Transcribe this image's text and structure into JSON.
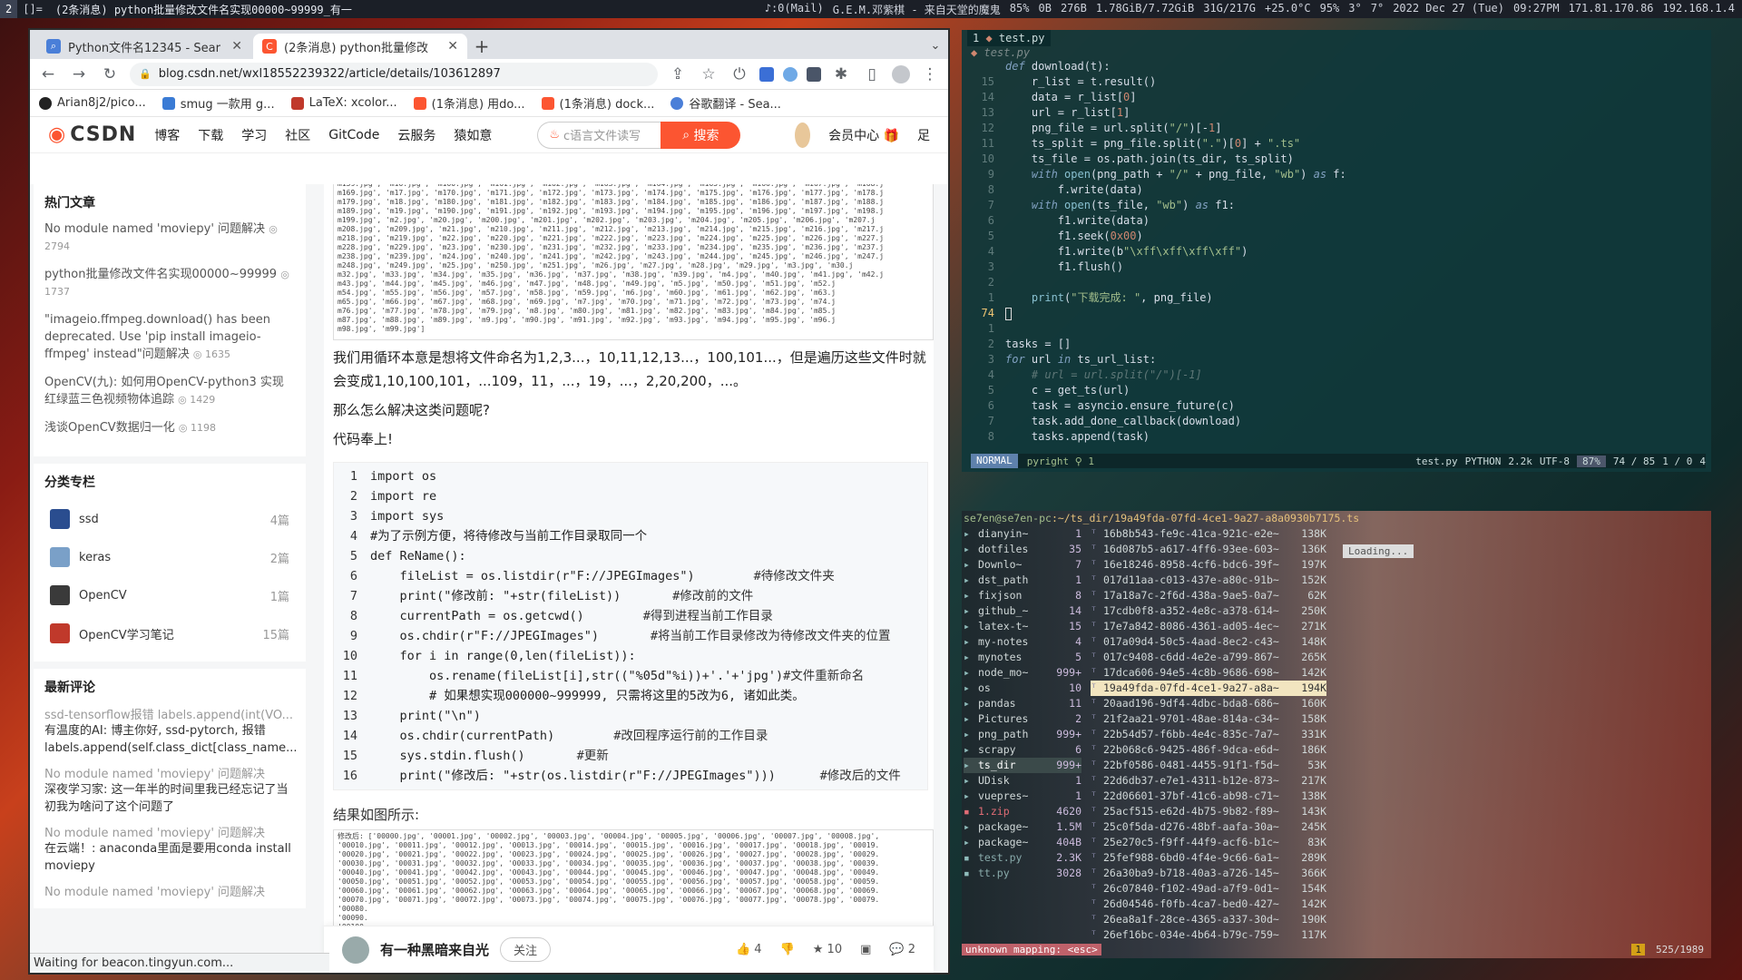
{
  "topbar": {
    "workspaces": [
      "2",
      "[]="
    ],
    "window_title": "(2条消息) python批量修改文件名实现00000~99999_有一",
    "stats": [
      "♪:0(Mail)",
      "G.E.M.邓紫棋 - 来自天堂的魔鬼",
      "85%",
      "0B",
      "276B",
      "1.78GiB/7.72GiB",
      "31G/217G",
      "+25.0°C",
      "95%",
      "3°",
      "7°",
      "2022 Dec 27 (Tue)",
      "09:27PM",
      "171.81.170.86",
      "192.168.1.4"
    ]
  },
  "browser": {
    "tabs": [
      {
        "label": "Python文件名12345 - Sear",
        "icon": "search-icon"
      },
      {
        "label": "(2条消息) python批量修改",
        "icon": "csdn-icon"
      }
    ],
    "url": "blog.csdn.net/wxl18552239322/article/details/103612897",
    "bookmarks": [
      "Arian8j2/pico...",
      "smug 一款用 g...",
      "LaTeX:  xcolor...",
      "(1条消息) 用do...",
      "(1条消息) dock...",
      "谷歌翻译 - Sea..."
    ],
    "status": "Waiting for beacon.tingyun.com..."
  },
  "csdn": {
    "logo": "CSDN",
    "nav": [
      "博客",
      "下载",
      "学习",
      "社区",
      "GitCode",
      "云服务",
      "猿如意"
    ],
    "search_placeholder": "c语言文件读写",
    "search_button": "搜索",
    "member": "会员中心",
    "more": "足"
  },
  "sidebar": {
    "hot_title": "热门文章",
    "hot": [
      {
        "title": "No module named 'moviepy' 问题解决",
        "views": "2794"
      },
      {
        "title": "python批量修改文件名实现00000~99999",
        "views": "1737"
      },
      {
        "title": "\"imageio.ffmpeg.download() has been deprecated. Use 'pip install imageio-ffmpeg' instead\"问题解决",
        "views": "1635"
      },
      {
        "title": "OpenCV(九): 如何用OpenCV-python3 实现红绿蓝三色视频物体追踪",
        "views": "1429"
      },
      {
        "title": "浅谈OpenCV数据归一化",
        "views": "1198"
      }
    ],
    "columns_title": "分类专栏",
    "columns": [
      {
        "name": "ssd",
        "count": "4篇"
      },
      {
        "name": "keras",
        "count": "2篇"
      },
      {
        "name": "OpenCV",
        "count": "1篇"
      },
      {
        "name": "OpenCV学习笔记",
        "count": "15篇"
      }
    ],
    "comments_title": "最新评论",
    "comments": [
      {
        "who": "ssd-tensorflow报错 labels.append(int(VO...",
        "text": "有温度的AI: 博主你好, ssd-pytorch, 报错labels.append(self.class_dict[class_name..."
      },
      {
        "who": "No module named 'moviepy' 问题解决",
        "text": "深夜学习家: 这一年半的时间里我已经忘记了当初我为啥问了这个问题了"
      },
      {
        "who": "No module named 'moviepy' 问题解决",
        "text": "在云端！: anaconda里面是要用conda install moviepy"
      },
      {
        "who": "No module named 'moviepy' 问题解决",
        "text": ""
      }
    ]
  },
  "article": {
    "img_top_lines": [
      "m159.jpg', 'm16.jpg', 'm160.jpg', 'm161.jpg', 'm162.jpg', 'm163.jpg', 'm164.jpg', 'm165.jpg', 'm166.jpg', 'm167.jpg', 'm168.j",
      "m169.jpg', 'm17.jpg', 'm170.jpg', 'm171.jpg', 'm172.jpg', 'm173.jpg', 'm174.jpg', 'm175.jpg', 'm176.jpg', 'm177.jpg', 'm178.j",
      "m179.jpg', 'm18.jpg', 'm180.jpg', 'm181.jpg', 'm182.jpg', 'm183.jpg', 'm184.jpg', 'm185.jpg', 'm186.jpg', 'm187.jpg', 'm188.j",
      "m189.jpg', 'm19.jpg', 'm190.jpg', 'm191.jpg', 'm192.jpg', 'm193.jpg', 'm194.jpg', 'm195.jpg', 'm196.jpg', 'm197.jpg', 'm198.j",
      "m199.jpg', 'm2.jpg', 'm20.jpg', 'm200.jpg', 'm201.jpg', 'm202.jpg', 'm203.jpg', 'm204.jpg', 'm205.jpg', 'm206.jpg', 'm207.j",
      "m208.jpg', 'm209.jpg', 'm21.jpg', 'm210.jpg', 'm211.jpg', 'm212.jpg', 'm213.jpg', 'm214.jpg', 'm215.jpg', 'm216.jpg', 'm217.j",
      "m218.jpg', 'm219.jpg', 'm22.jpg', 'm220.jpg', 'm221.jpg', 'm222.jpg', 'm223.jpg', 'm224.jpg', 'm225.jpg', 'm226.jpg', 'm227.j",
      "m228.jpg', 'm229.jpg', 'm23.jpg', 'm230.jpg', 'm231.jpg', 'm232.jpg', 'm233.jpg', 'm234.jpg', 'm235.jpg', 'm236.jpg', 'm237.j",
      "m238.jpg', 'm239.jpg', 'm24.jpg', 'm240.jpg', 'm241.jpg', 'm242.jpg', 'm243.jpg', 'm244.jpg', 'm245.jpg', 'm246.jpg', 'm247.j",
      "m248.jpg', 'm249.jpg', 'm25.jpg', 'm250.jpg', 'm251.jpg', 'm26.jpg', 'm27.jpg', 'm28.jpg', 'm29.jpg', 'm3.jpg', 'm30.j",
      "m32.jpg', 'm33.jpg', 'm34.jpg', 'm35.jpg', 'm36.jpg', 'm37.jpg', 'm38.jpg', 'm39.jpg', 'm4.jpg', 'm40.jpg', 'm41.jpg', 'm42.j",
      "m43.jpg', 'm44.jpg', 'm45.jpg', 'm46.jpg', 'm47.jpg', 'm48.jpg', 'm49.jpg', 'm5.jpg', 'm50.jpg', 'm51.jpg', 'm52.j",
      "m54.jpg', 'm55.jpg', 'm56.jpg', 'm57.jpg', 'm58.jpg', 'm59.jpg', 'm6.jpg', 'm60.jpg', 'm61.jpg', 'm62.jpg', 'm63.j",
      "m65.jpg', 'm66.jpg', 'm67.jpg', 'm68.jpg', 'm69.jpg', 'm7.jpg', 'm70.jpg', 'm71.jpg', 'm72.jpg', 'm73.jpg', 'm74.j",
      "m76.jpg', 'm77.jpg', 'm78.jpg', 'm79.jpg', 'm8.jpg', 'm80.jpg', 'm81.jpg', 'm82.jpg', 'm83.jpg', 'm84.jpg', 'm85.j",
      "m87.jpg', 'm88.jpg', 'm89.jpg', 'm9.jpg', 'm90.jpg', 'm91.jpg', 'm92.jpg', 'm93.jpg', 'm94.jpg', 'm95.jpg', 'm96.j",
      "m98.jpg', 'm99.jpg']"
    ],
    "paragraphs": [
      "我们用循环本意是想将文件命名为1,2,3...，10,11,12,13...，100,101...，但是遍历这些文件时就会变成1,10,100,101，...109，11，...，19，...，2,20,200，...。",
      "那么怎么解决这类问题呢?",
      "代码奉上!"
    ],
    "code": [
      {
        "code": "import os",
        "comment": ""
      },
      {
        "code": "import re",
        "comment": ""
      },
      {
        "code": "import sys",
        "comment": ""
      },
      {
        "code": "#为了示例方便，将待修改与当前工作目录取同一个",
        "comment": ""
      },
      {
        "code": "def ReName():",
        "comment": ""
      },
      {
        "code": "    fileList = os.listdir(r\"F://JPEGImages\")        ",
        "comment": "#待修改文件夹"
      },
      {
        "code": "    print(\"修改前: \"+str(fileList))       ",
        "comment": "#修改前的文件"
      },
      {
        "code": "    currentPath = os.getcwd()        ",
        "comment": "#得到进程当前工作目录"
      },
      {
        "code": "    os.chdir(r\"F://JPEGImages\")       ",
        "comment": "#将当前工作目录修改为待修改文件夹的位置"
      },
      {
        "code": "    for i in range(0,len(fileList)):",
        "comment": ""
      },
      {
        "code": "        os.rename(fileList[i],str((\"%05d\"%i))+'.'+'jpg')",
        "comment": "#文件重新命名"
      },
      {
        "code": "        # 如果想实现000000~999999, 只需将这里的5改为6, 诸如此类。",
        "comment": ""
      },
      {
        "code": "    print(\"\\n\")",
        "comment": ""
      },
      {
        "code": "    os.chdir(currentPath)        ",
        "comment": "#改回程序运行前的工作目录"
      },
      {
        "code": "    sys.stdin.flush()       ",
        "comment": "#更新"
      },
      {
        "code": "    print(\"修改后: \"+str(os.listdir(r\"F://JPEGImages\")))      ",
        "comment": "#修改后的文件"
      }
    ],
    "result_label": "结果如图所示:",
    "img_bottom_lines": [
      "修改后: ['00000.jpg', '00001.jpg', '00002.jpg', '00003.jpg', '00004.jpg', '00005.jpg', '00006.jpg', '00007.jpg', '00008.jpg',",
      "'00010.jpg', '00011.jpg', '00012.jpg', '00013.jpg', '00014.jpg', '00015.jpg', '00016.jpg', '00017.jpg', '00018.jpg', '00019.",
      "'00020.jpg', '00021.jpg', '00022.jpg', '00023.jpg', '00024.jpg', '00025.jpg', '00026.jpg', '00027.jpg', '00028.jpg', '00029.",
      "'00030.jpg', '00031.jpg', '00032.jpg', '00033.jpg', '00034.jpg', '00035.jpg', '00036.jpg', '00037.jpg', '00038.jpg', '00039.",
      "'00040.jpg', '00041.jpg', '00042.jpg', '00043.jpg', '00044.jpg', '00045.jpg', '00046.jpg', '00047.jpg', '00048.jpg', '00049.",
      "'00050.jpg', '00051.jpg', '00052.jpg', '00053.jpg', '00054.jpg', '00055.jpg', '00056.jpg', '00057.jpg', '00058.jpg', '00059.",
      "'00060.jpg', '00061.jpg', '00062.jpg', '00063.jpg', '00064.jpg', '00065.jpg', '00066.jpg', '00067.jpg', '00068.jpg', '00069.",
      "'00070.jpg', '00071.jpg', '00072.jpg', '00073.jpg', '00074.jpg', '00075.jpg', '00076.jpg', '00077.jpg', '00078.jpg', '00079.",
      "'00080.",
      "'00090.",
      "'00100.",
      "'00110.",
      "'00120.",
      "'00130."
    ],
    "author": "有一种黑暗来自光",
    "follow": "关注",
    "likes": "4",
    "stars": "10",
    "comments": "2"
  },
  "editor": {
    "tab": "test.py",
    "file": "test.py",
    "lines": [
      {
        "n": "",
        "code": "def download(t):"
      },
      {
        "n": "15",
        "code": "    r_list = t.result()"
      },
      {
        "n": "14",
        "code": "    data = r_list[0]"
      },
      {
        "n": "13",
        "code": "    url = r_list[1]"
      },
      {
        "n": "12",
        "code": "    png_file = url.split(\"/\")[-1]"
      },
      {
        "n": "11",
        "code": "    ts_split = png_file.split(\".\")[0] + \".ts\""
      },
      {
        "n": "10",
        "code": "    ts_file = os.path.join(ts_dir, ts_split)"
      },
      {
        "n": "9",
        "code": "    with open(png_path + \"/\" + png_file, \"wb\") as f:"
      },
      {
        "n": "8",
        "code": "        f.write(data)"
      },
      {
        "n": "7",
        "code": "    with open(ts_file, \"wb\") as f1:"
      },
      {
        "n": "6",
        "code": "        f1.write(data)"
      },
      {
        "n": "5",
        "code": "        f1.seek(0x00)"
      },
      {
        "n": "4",
        "code": "        f1.write(b\"\\xff\\xff\\xff\\xff\")"
      },
      {
        "n": "3",
        "code": "        f1.flush()"
      },
      {
        "n": "2",
        "code": ""
      },
      {
        "n": "1",
        "code": "    print(\"下载完成: \", png_file)"
      },
      {
        "n": "74",
        "code": ""
      },
      {
        "n": "1",
        "code": ""
      },
      {
        "n": "2",
        "code": "tasks = []"
      },
      {
        "n": "3",
        "code": "for url in ts_url_list:"
      },
      {
        "n": "4",
        "code": "    # url = url.split(\"/\")[-1]"
      },
      {
        "n": "5",
        "code": "    c = get_ts(url)"
      },
      {
        "n": "6",
        "code": "    task = asyncio.ensure_future(c)"
      },
      {
        "n": "7",
        "code": "    task.add_done_callback(download)"
      },
      {
        "n": "8",
        "code": "    tasks.append(task)"
      }
    ],
    "status": {
      "mode": "NORMAL",
      "lsp": "pyright",
      "diag": "1",
      "file": "test.py",
      "lang": "PYTHON",
      "size": "2.2k",
      "enc": "UTF-8",
      "pct": "87%",
      "pos": "74 /  85",
      "col": "1 /  0",
      "extra": "4"
    }
  },
  "filemanager": {
    "user": "se7en@se7en-pc",
    "path": ":~/ts_dir/19a49fda-07fd-4ce1-9a27-a8a0930b7175.ts",
    "loading": "Loading...",
    "left": [
      {
        "name": "dianyin~",
        "count": "1"
      },
      {
        "name": "dotfiles",
        "count": "35"
      },
      {
        "name": "Downlo~",
        "count": "7"
      },
      {
        "name": "dst_path",
        "count": "1"
      },
      {
        "name": "fixjson",
        "count": "8"
      },
      {
        "name": "github_~",
        "count": "14"
      },
      {
        "name": "latex-t~",
        "count": "15"
      },
      {
        "name": "my-notes",
        "count": "4"
      },
      {
        "name": "mynotes",
        "count": "5"
      },
      {
        "name": "node_mo~",
        "count": "999+"
      },
      {
        "name": "os",
        "count": "10"
      },
      {
        "name": "pandas",
        "count": "11"
      },
      {
        "name": "Pictures",
        "count": "2"
      },
      {
        "name": "png_path",
        "count": "999+"
      },
      {
        "name": "scrapy",
        "count": "6"
      },
      {
        "name": "ts_dir",
        "count": "999+"
      },
      {
        "name": "UDisk",
        "count": "1"
      },
      {
        "name": "vuepres~",
        "count": "1"
      },
      {
        "name": "1.zip",
        "count": "4620"
      },
      {
        "name": "package~",
        "count": "1.5M"
      },
      {
        "name": "package~",
        "count": "404B"
      },
      {
        "name": "test.py",
        "count": "2.3K"
      },
      {
        "name": "tt.py",
        "count": "3028"
      }
    ],
    "right": [
      {
        "name": "16b8b543-fe9c-41ca-921c-e2e~",
        "size": "138K"
      },
      {
        "name": "16d087b5-a617-4ff6-93ee-603~",
        "size": "136K"
      },
      {
        "name": "16e18246-8958-4cf6-bdc6-39f~",
        "size": "197K"
      },
      {
        "name": "017d11aa-c013-437e-a80c-91b~",
        "size": "152K"
      },
      {
        "name": "17a18a7c-2f6d-438a-9ae5-0a7~",
        "size": "62K"
      },
      {
        "name": "17cdb0f8-a352-4e8c-a378-614~",
        "size": "250K"
      },
      {
        "name": "17e7a842-8086-4361-ad05-4ec~",
        "size": "271K"
      },
      {
        "name": "017a09d4-50c5-4aad-8ec2-c43~",
        "size": "148K"
      },
      {
        "name": "017c9408-c6dd-4e2e-a799-867~",
        "size": "265K"
      },
      {
        "name": "17dca606-94e5-4c8b-9686-698~",
        "size": "142K"
      },
      {
        "name": "19a49fda-07fd-4ce1-9a27-a8a~",
        "size": "194K"
      },
      {
        "name": "20aad196-9df4-4dbc-bda8-686~",
        "size": "160K"
      },
      {
        "name": "21f2aa21-9701-48ae-814a-c34~",
        "size": "158K"
      },
      {
        "name": "22b54d57-f6bb-4e4c-835c-7a7~",
        "size": "331K"
      },
      {
        "name": "22b068c6-9425-486f-9dca-e6d~",
        "size": "186K"
      },
      {
        "name": "22bf0586-0481-4455-91f1-f5d~",
        "size": "53K"
      },
      {
        "name": "22d6db37-e7e1-4311-b12e-873~",
        "size": "217K"
      },
      {
        "name": "22d06601-37bf-41c6-ab98-c71~",
        "size": "138K"
      },
      {
        "name": "25acf515-e62d-4b75-9b82-f89~",
        "size": "143K"
      },
      {
        "name": "25c0f5da-d276-48bf-aafa-30a~",
        "size": "245K"
      },
      {
        "name": "25e270c5-f9ff-44f9-acf6-b1c~",
        "size": "83K"
      },
      {
        "name": "25fef988-6bd0-4f4e-9c66-6a1~",
        "size": "289K"
      },
      {
        "name": "26a30ba9-b718-40a3-a726-145~",
        "size": "366K"
      },
      {
        "name": "26c07840-f102-49ad-a7f9-0d1~",
        "size": "154K"
      },
      {
        "name": "26d04546-f0fb-4ca7-bed0-427~",
        "size": "142K"
      },
      {
        "name": "26ea8a1f-28ce-4365-a337-30d~",
        "size": "190K"
      },
      {
        "name": "26ef16bc-034e-4b64-b79c-759~",
        "size": "117K"
      }
    ],
    "error": "unknown mapping: <esc>",
    "count": "1",
    "pos": "525/1989"
  }
}
